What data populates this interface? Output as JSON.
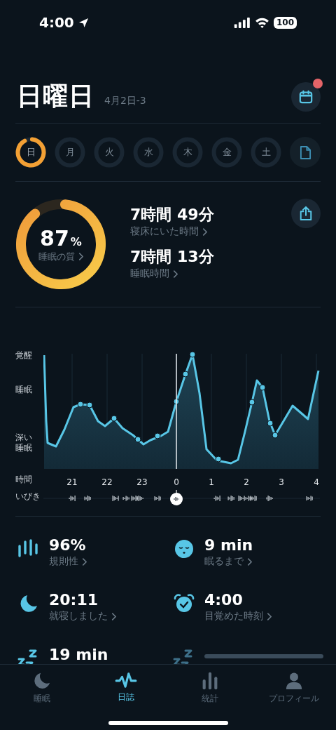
{
  "status_bar": {
    "time": "4:00",
    "battery": "100"
  },
  "header": {
    "title": "日曜日",
    "date": "4月2日-3",
    "calendar_badge": true
  },
  "days": [
    {
      "label": "日",
      "selected": true
    },
    {
      "label": "月",
      "selected": false
    },
    {
      "label": "火",
      "selected": false
    },
    {
      "label": "水",
      "selected": false
    },
    {
      "label": "木",
      "selected": false
    },
    {
      "label": "金",
      "selected": false
    },
    {
      "label": "土",
      "selected": false
    }
  ],
  "summary": {
    "quality": {
      "value": "87",
      "unit": "%",
      "label": "睡眠の質"
    },
    "metrics": [
      {
        "value": "7時間 49分",
        "label": "寝床にいた時間"
      },
      {
        "value": "7時間 13分",
        "label": "睡眠時間"
      }
    ]
  },
  "hypnogram": {
    "stage_labels": [
      "覚醒",
      "睡眠",
      "深い睡眠"
    ],
    "time_label": "時間",
    "hours": [
      "21",
      "22",
      "23",
      "0",
      "1",
      "2",
      "3",
      "4"
    ],
    "snore_label": "いびき"
  },
  "stats": [
    {
      "kind": "value",
      "value": "96%",
      "label": "規則性"
    },
    {
      "kind": "value",
      "value": "9 min",
      "label": "眠るまで"
    },
    {
      "kind": "value",
      "value": "20:11",
      "label": "就寝しました"
    },
    {
      "kind": "value",
      "value": "4:00",
      "label": "目覚めた時刻"
    },
    {
      "kind": "value",
      "value": "19 min"
    },
    {
      "kind": "loading"
    }
  ],
  "tab_bar": [
    {
      "label": "睡眠",
      "selected": false
    },
    {
      "label": "日誌",
      "selected": true
    },
    {
      "label": "統計",
      "selected": false
    },
    {
      "label": "プロフィール",
      "selected": false
    }
  ]
}
